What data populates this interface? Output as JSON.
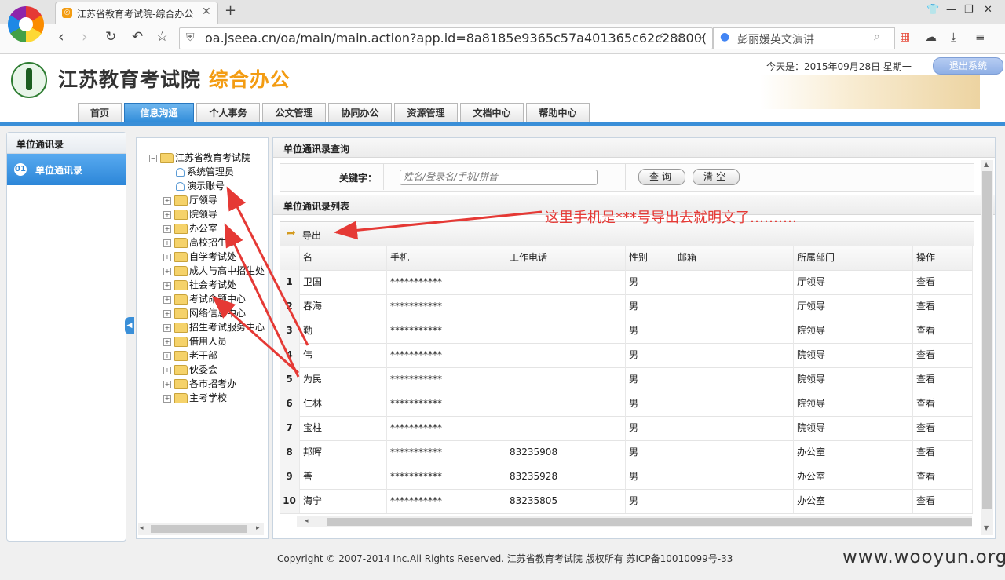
{
  "browser": {
    "tab_title": "江苏省教育考试院-综合办公",
    "url": "oa.jseea.cn/oa/main/main.action?app.id=8a8185e9365c57a401365c62c28800(",
    "search_text": "彭丽媛英文演讲"
  },
  "header": {
    "org_name": "江苏教育考试院",
    "system_name": "综合办公",
    "date": "今天是：2015年09月28日 星期一",
    "logout": "退出系统"
  },
  "nav": [
    "首页",
    "信息沟通",
    "个人事务",
    "公文管理",
    "协同办公",
    "资源管理",
    "文档中心",
    "帮助中心"
  ],
  "left_panel": {
    "title": "单位通讯录",
    "item_num": "01",
    "item_label": "单位通讯录"
  },
  "tree": {
    "root": "江苏省教育考试院",
    "users": [
      "系统管理员",
      "演示账号"
    ],
    "folders": [
      "厅领导",
      "院领导",
      "办公室",
      "高校招生处",
      "自学考试处",
      "成人与高中招生处",
      "社会考试处",
      "考试命题中心",
      "网络信息中心",
      "招生考试服务中心",
      "借用人员",
      "老干部",
      "伙委会",
      "各市招考办",
      "主考学校"
    ]
  },
  "query": {
    "section_title": "单位通讯录查询",
    "keyword_label": "关键字：",
    "placeholder": "姓名/登录名/手机/拼音",
    "search_btn": "查询",
    "clear_btn": "清空"
  },
  "list": {
    "section_title": "单位通讯录列表",
    "export_label": "导出",
    "columns": [
      "",
      "名",
      "手机",
      "工作电话",
      "性别",
      "邮箱",
      "所属部门",
      "操作"
    ],
    "rows": [
      [
        "1",
        "卫国",
        "***********",
        "",
        "男",
        "",
        "厅领导",
        "查看"
      ],
      [
        "2",
        "春海",
        "***********",
        "",
        "男",
        "",
        "厅领导",
        "查看"
      ],
      [
        "3",
        "勤",
        "***********",
        "",
        "男",
        "",
        "院领导",
        "查看"
      ],
      [
        "4",
        "伟",
        "***********",
        "",
        "男",
        "",
        "院领导",
        "查看"
      ],
      [
        "5",
        "为民",
        "***********",
        "",
        "男",
        "",
        "院领导",
        "查看"
      ],
      [
        "6",
        "仁林",
        "***********",
        "",
        "男",
        "",
        "院领导",
        "查看"
      ],
      [
        "7",
        "宝柱",
        "***********",
        "",
        "男",
        "",
        "院领导",
        "查看"
      ],
      [
        "8",
        "邦晖",
        "***********",
        "83235908",
        "男",
        "",
        "办公室",
        "查看"
      ],
      [
        "9",
        "善",
        "***********",
        "83235928",
        "男",
        "",
        "办公室",
        "查看"
      ],
      [
        "10",
        "海宁",
        "***********",
        "83235805",
        "男",
        "",
        "办公室",
        "查看"
      ]
    ]
  },
  "annotation": "这里手机是***号导出去就明文了……….",
  "footer": {
    "copyright": "Copyright © 2007-2014 Inc.All Rights Reserved.    江苏省教育考试院 版权所有 苏ICP备10010099号-33",
    "watermark": "www.wooyun.org"
  },
  "colors": {
    "accent": "#3a8fd8",
    "system_name": "#f39c12",
    "annotation": "#e53935"
  }
}
